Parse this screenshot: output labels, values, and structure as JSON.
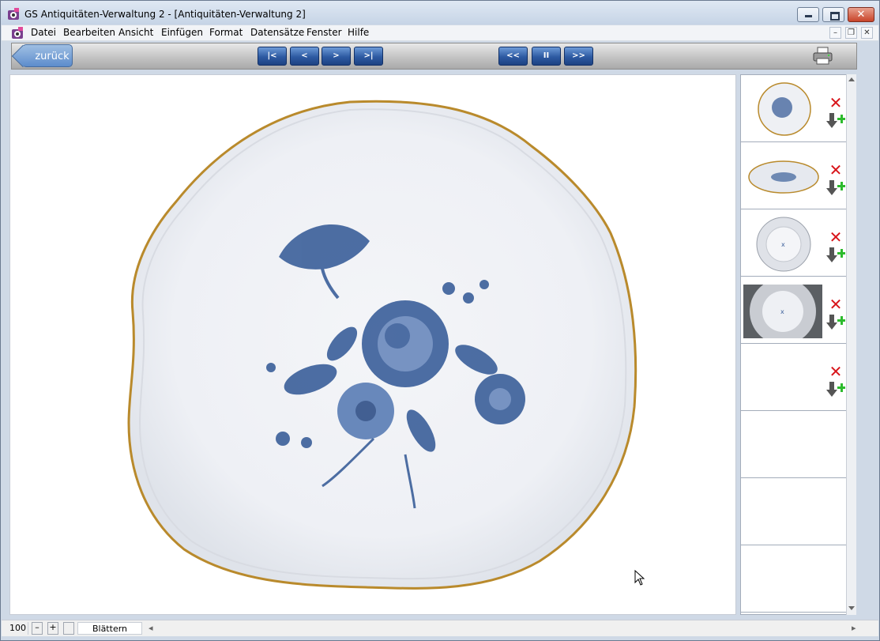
{
  "window": {
    "title": "GS Antiquitäten-Verwaltung 2 - [Antiquitäten-Verwaltung 2]",
    "controls": {
      "minimize": "minimize-icon",
      "maximize": "maximize-icon",
      "close": "close-icon"
    }
  },
  "menu": {
    "items": [
      "Datei",
      "Bearbeiten",
      "Ansicht",
      "Einfügen",
      "Format",
      "Datensätze",
      "Fenster",
      "Hilfe"
    ],
    "mdi_controls": {
      "minimize": "–",
      "restore": "❐",
      "close": "✕"
    }
  },
  "toolbar": {
    "back_label": "zurück",
    "nav": {
      "first": "|<",
      "prev": "<",
      "next": ">",
      "last": ">|"
    },
    "slideshow": {
      "rewind": "<<",
      "pause": "II",
      "forward": ">>"
    },
    "print_icon": "printer-icon",
    "accent": "#2d5aa2"
  },
  "image_viewer": {
    "subject": "plate-image",
    "rim_color": "#b98a2c",
    "decor_color": "#3b5f9a"
  },
  "thumbnails": {
    "count_slots": 8,
    "items": [
      {
        "kind": "plate-top",
        "delete_icon": "delete-x-icon",
        "add_icon": "add-down-arrow-icon"
      },
      {
        "kind": "plate-side",
        "delete_icon": "delete-x-icon",
        "add_icon": "add-down-arrow-icon"
      },
      {
        "kind": "plate-bottom",
        "delete_icon": "delete-x-icon",
        "add_icon": "add-down-arrow-icon"
      },
      {
        "kind": "plate-bottom-dark",
        "delete_icon": "delete-x-icon",
        "add_icon": "add-down-arrow-icon"
      },
      {
        "kind": "empty",
        "delete_icon": "delete-x-icon",
        "add_icon": "add-down-arrow-icon"
      }
    ]
  },
  "status": {
    "zoom": "100",
    "mode": "Blättern"
  }
}
